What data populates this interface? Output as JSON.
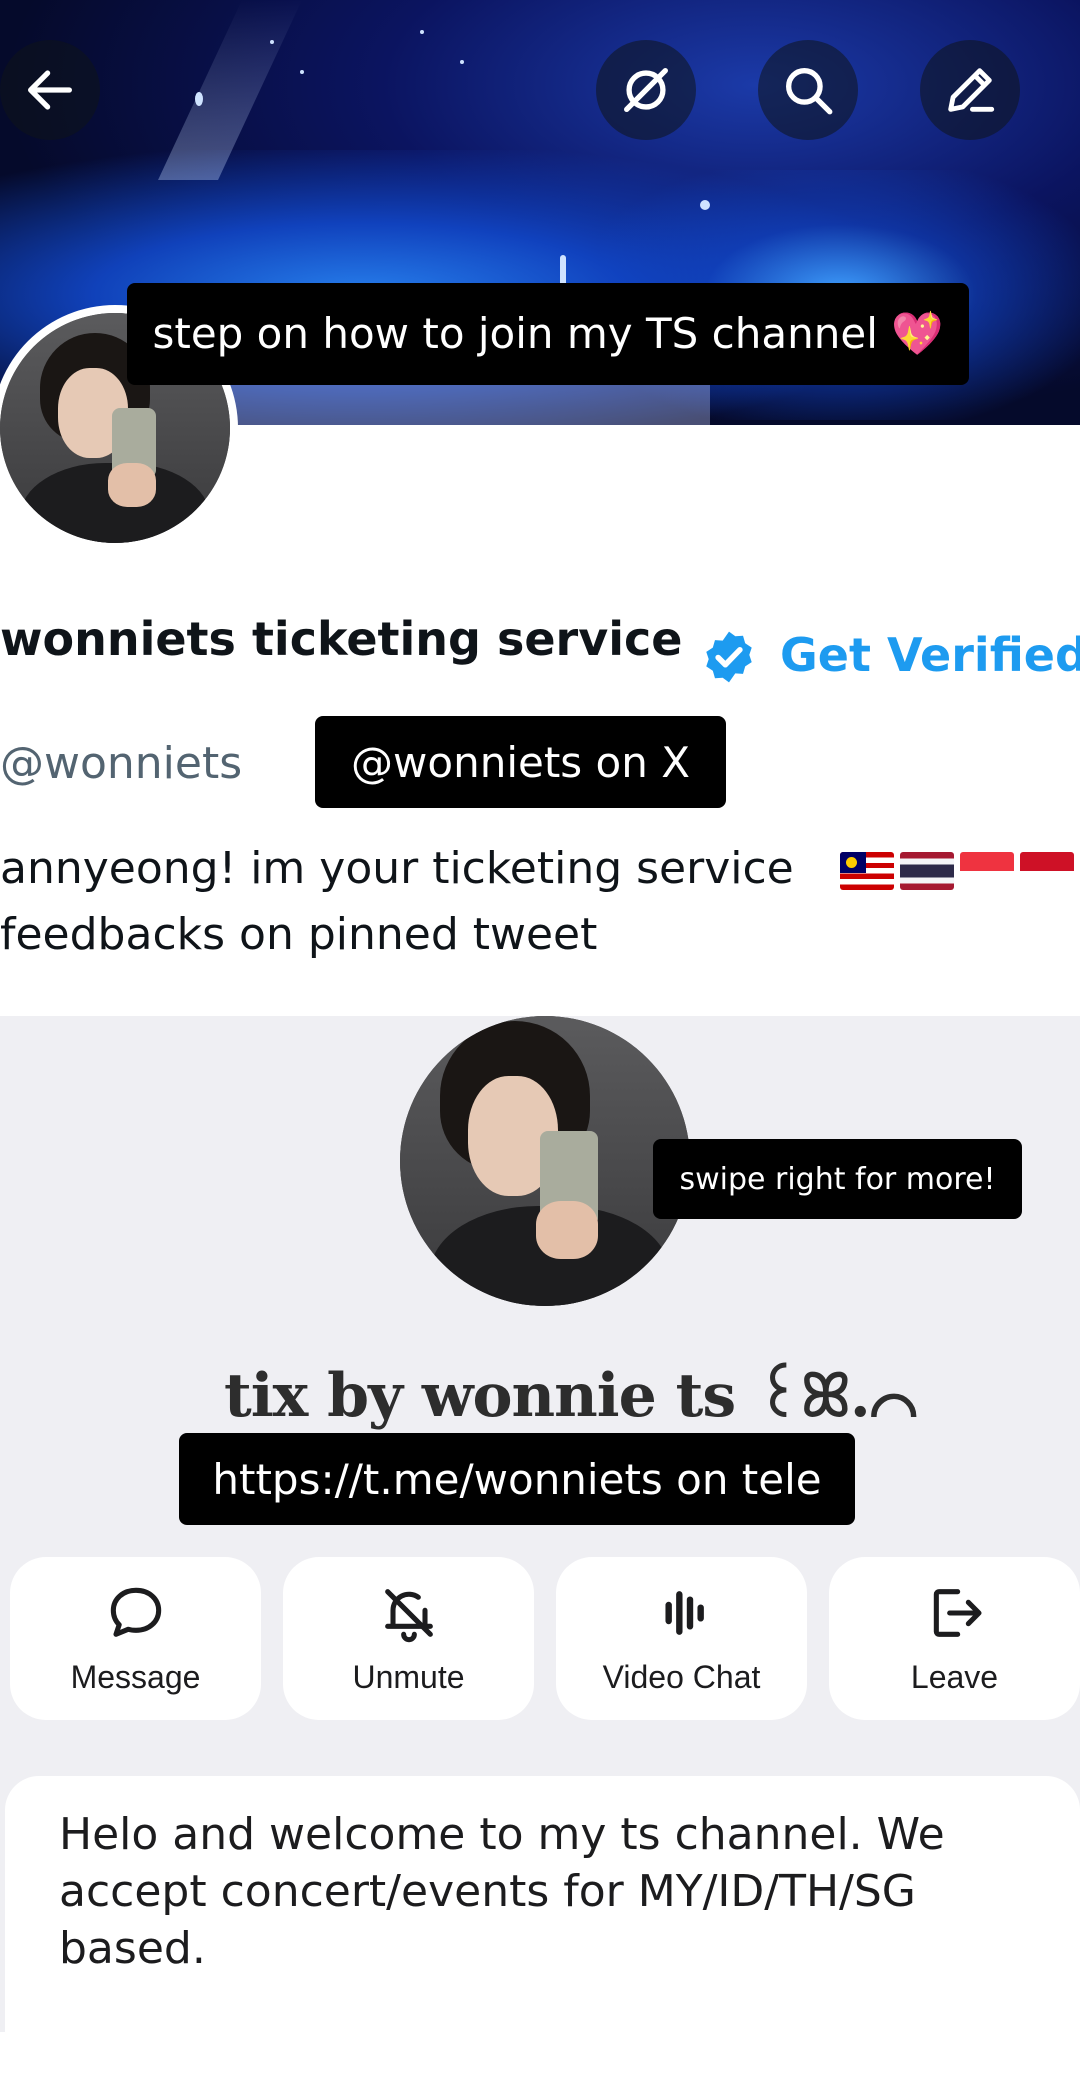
{
  "overlays": {
    "top_caption": "step on how to join my TS channel 💖",
    "x_caption": "@wonniets on X",
    "swipe_caption": "swipe right for more!",
    "tele_caption": "https://t.me/wonniets on tele"
  },
  "x_profile": {
    "name": "wonniets ticketing service",
    "get_verified": "Get Verified",
    "handle": "@wonniets",
    "bio_line1": "annyeong! im your ticketing service",
    "bio_separator": "|",
    "bio_line2": "feedbacks on pinned tweet",
    "flags": [
      "malaysia-flag",
      "thailand-flag",
      "singapore-flag",
      "indonesia-flag"
    ],
    "verified_color": "#1d9bf0"
  },
  "header_icons": [
    "back-arrow-icon",
    "grok-icon",
    "search-icon",
    "edit-icon"
  ],
  "telegram_channel": {
    "title": "tix by wonnie ts ꒰ꕤ.⌒",
    "actions": [
      {
        "label": "Message",
        "icon": "message-bubble-icon"
      },
      {
        "label": "Unmute",
        "icon": "bell-slash-icon"
      },
      {
        "label": "Video Chat",
        "icon": "voice-bars-icon"
      },
      {
        "label": "Leave",
        "icon": "leave-icon"
      }
    ],
    "description": "Helo and welcome to my ts channel. We accept concert/events for MY/ID/TH/SG based."
  }
}
